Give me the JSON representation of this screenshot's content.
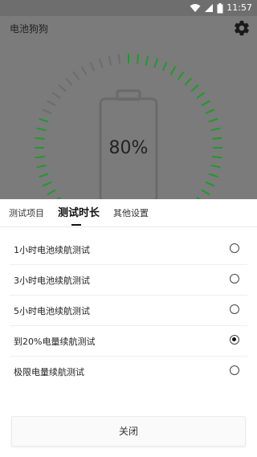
{
  "status_bar": {
    "time": "11:57",
    "icons": [
      "wifi-icon",
      "signal-icon",
      "battery-icon"
    ]
  },
  "app": {
    "title": "电池狗狗",
    "settings_icon": "gear-icon"
  },
  "battery": {
    "percent_label": "80%",
    "level": 0.8,
    "gauge_color": "#1e9a2a"
  },
  "sheet": {
    "tabs": [
      {
        "label": "测试项目",
        "active": false
      },
      {
        "label": "测试时长",
        "active": true
      },
      {
        "label": "其他设置",
        "active": false
      }
    ],
    "options": [
      {
        "label": "1小时电池续航测试",
        "selected": false
      },
      {
        "label": "3小时电池续航测试",
        "selected": false
      },
      {
        "label": "5小时电池续航测试",
        "selected": false
      },
      {
        "label": "到20%电量续航测试",
        "selected": true
      },
      {
        "label": "极限电量续航测试",
        "selected": false
      }
    ],
    "close_label": "关闭"
  }
}
